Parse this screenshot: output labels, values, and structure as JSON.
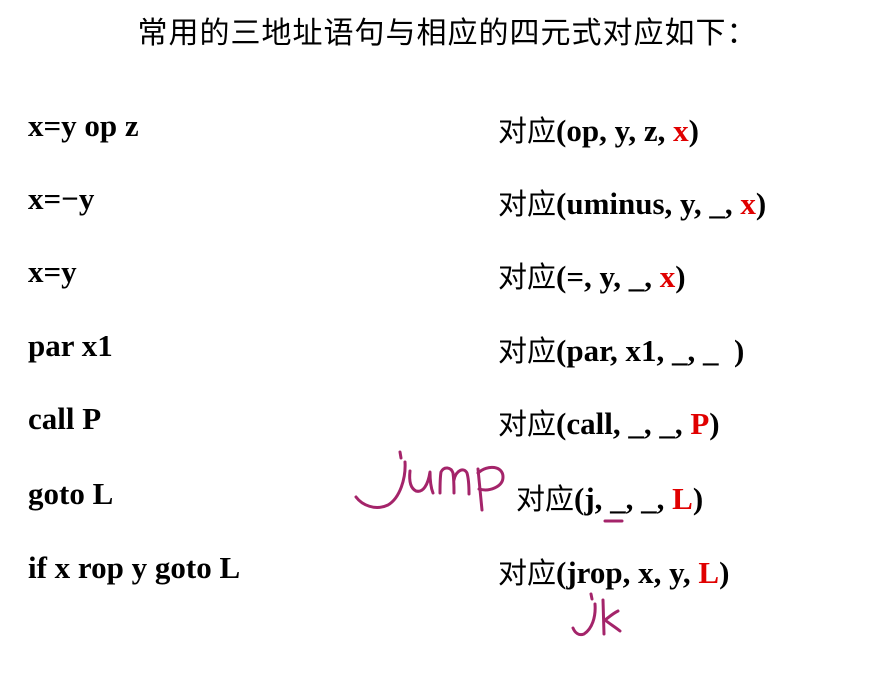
{
  "title": "常用的三地址语句与相应的四元式对应如下：",
  "rows": [
    {
      "stmt": "x=y op z",
      "cn": "对应",
      "pre": "(op, y, z, ",
      "res": "x",
      "post": ")"
    },
    {
      "stmt": "x=−y",
      "cn": "对应",
      "pre": "(uminus, y, _, ",
      "res": "x",
      "post": ")"
    },
    {
      "stmt": "x=y",
      "cn": "对应",
      "pre": "(=, y, _, ",
      "res": "x",
      "post": ")"
    },
    {
      "stmt": "par x1",
      "cn": "对应",
      "pre": "(par, x1, _, _  ",
      "res": "",
      "post": ")"
    },
    {
      "stmt": "call P",
      "cn": "对应",
      "pre": "(call, _, _, ",
      "res": "P",
      "post": ")"
    },
    {
      "stmt": "goto L",
      "cn": "对应",
      "pre": "(j, _, _, ",
      "res": "L",
      "post": ")"
    },
    {
      "stmt": "if x rop y goto L",
      "cn": "对应",
      "pre": "(jrop, x, y, ",
      "res": "L",
      "post": ")"
    }
  ],
  "annotations": {
    "ink_color": "#a4246a",
    "notes": [
      "jump",
      "jr"
    ]
  }
}
